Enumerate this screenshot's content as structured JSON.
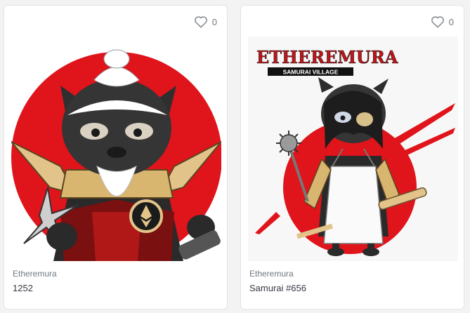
{
  "cards": [
    {
      "collection": "Etheremura",
      "name": "1252",
      "favorites": "0",
      "icon": "heart-outline-icon"
    },
    {
      "collection": "Etheremura",
      "name": "Samurai #656",
      "favorites": "0",
      "icon": "heart-outline-icon",
      "logo_title": "ETHEREMURA",
      "logo_subtitle": "SAMURAI VILLAGE"
    }
  ],
  "colors": {
    "sun_red": "#e0141b",
    "card_bg": "#ffffff",
    "page_bg": "#f3f3f3",
    "muted_text": "#707a83",
    "body_text": "#353840"
  }
}
